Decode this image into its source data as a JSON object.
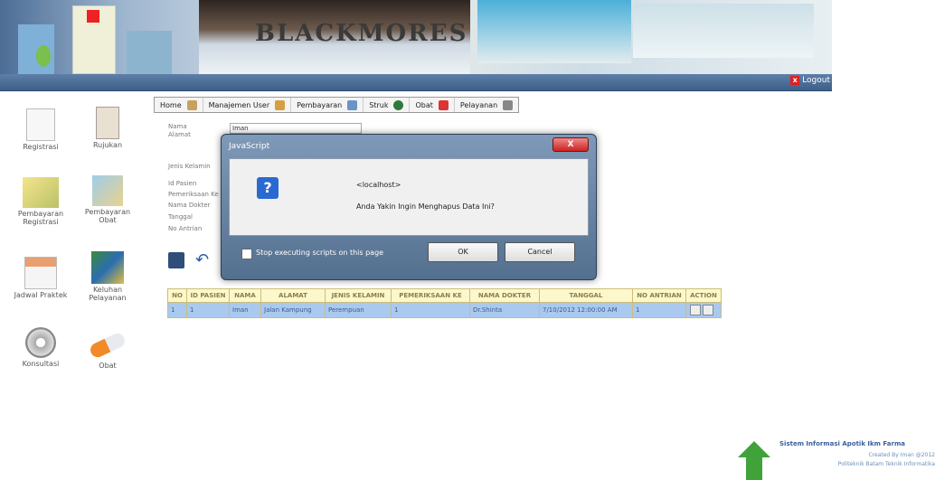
{
  "header": {
    "banner_text": "BLACKMORES",
    "logout_label": "Logout"
  },
  "sidebar": {
    "items": [
      {
        "label": "Registrasi",
        "icon": "document-icon"
      },
      {
        "label": "Rujukan",
        "icon": "clipboard-icon"
      },
      {
        "label": "Pembayaran Registrasi",
        "icon": "payment-icon"
      },
      {
        "label": "Pembayaran Obat",
        "icon": "payment-box-icon"
      },
      {
        "label": "Jadwal Praktek",
        "icon": "calendar-icon"
      },
      {
        "label": "Keluhan Pelayanan",
        "icon": "books-icon"
      },
      {
        "label": "Konsultasi",
        "icon": "cd-icon"
      },
      {
        "label": "Obat",
        "icon": "pill-icon"
      }
    ]
  },
  "menu": {
    "items": [
      {
        "label": "Home"
      },
      {
        "label": "Manajemen User"
      },
      {
        "label": "Pembayaran"
      },
      {
        "label": "Struk"
      },
      {
        "label": "Obat"
      },
      {
        "label": "Pelayanan"
      }
    ]
  },
  "form": {
    "name_label": "Nama",
    "name_value": "Iman",
    "address_label": "Alamat",
    "gender_label": "Jenis Kelamin",
    "patient_id_label": "Id Pasien",
    "exam_label": "Pemeriksaan Ke",
    "doctor_label": "Nama Dokter",
    "date_label": "Tanggal",
    "queue_label": "No Antrian"
  },
  "dialog": {
    "title": "JavaScript",
    "close_label": "X",
    "origin": "<localhost>",
    "message": "Anda Yakin Ingin Menghapus Data Ini?",
    "checkbox_label": "Stop executing scripts on this page",
    "ok_label": "OK",
    "cancel_label": "Cancel"
  },
  "table": {
    "headers": [
      "NO",
      "ID PASIEN",
      "NAMA",
      "ALAMAT",
      "JENIS KELAMIN",
      "PEMERIKSAAN KE",
      "NAMA DOKTER",
      "TANGGAL",
      "NO ANTRIAN",
      "ACTION"
    ],
    "rows": [
      [
        "1",
        "1",
        "Iman",
        "Jalan Kampung",
        "Perempuan",
        "1",
        "Dr.Shinta",
        "7/10/2012 12:00:00 AM",
        "1",
        ""
      ]
    ]
  },
  "footer": {
    "title": "Sistem Informasi Apotik Ikm Farma",
    "created": "Created By Iman @2012",
    "institution": "Politeknik Batam Teknik Informatika"
  },
  "colors": {
    "bar": "#3d5f88",
    "table_header": "#fdf7cc",
    "table_row": "#a9c9ef",
    "arrow": "#3fa33a"
  }
}
